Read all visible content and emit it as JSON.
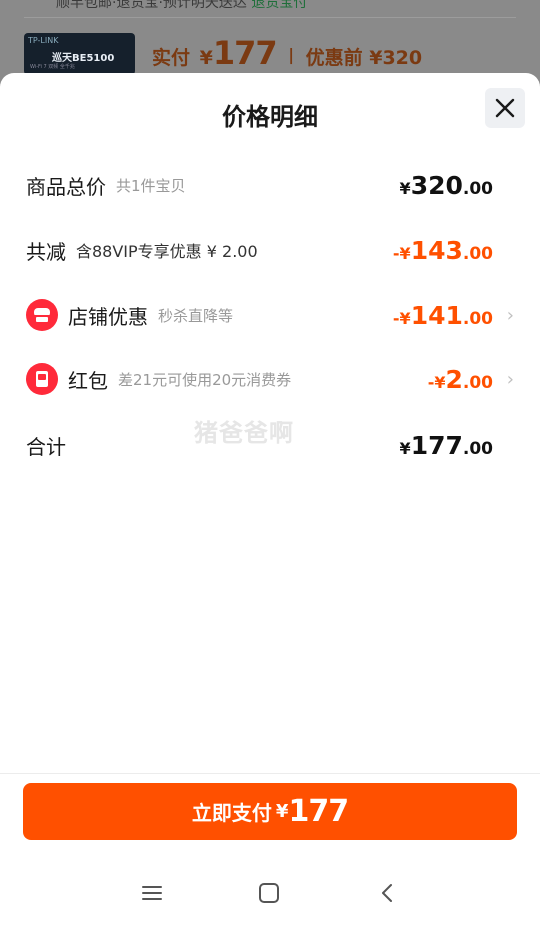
{
  "background": {
    "strip_text": "顺丰包邮·退货宝·预计明天送达",
    "strip_green": "退货宝付",
    "thumbnail_tag": "TP-LINK",
    "thumbnail_title": "巡天BE5100",
    "thumbnail_sub": "Wi-Fi 7 双频 全千兆",
    "price_label": "实付",
    "price_yen": "¥",
    "price_value": "177",
    "price_before": "优惠前 ¥320"
  },
  "sheet": {
    "title": "价格明细",
    "rows": [
      {
        "label": "商品总价",
        "sub": "共1件宝贝",
        "yen": "¥",
        "int": "320",
        "dec": ".00"
      },
      {
        "label": "共减",
        "sub": "含88VIP专享优惠 ¥ 2.00",
        "yen": "-¥",
        "int": "143",
        "dec": ".00"
      },
      {
        "label": "店铺优惠",
        "sub": "秒杀直降等",
        "yen": "-¥",
        "int": "141",
        "dec": ".00",
        "icon": "store-icon"
      },
      {
        "label": "红包",
        "sub": "差21元可使用20元消费券",
        "yen": "-¥",
        "int": "2",
        "dec": ".00",
        "icon": "red-packet-icon"
      },
      {
        "label": "合计",
        "yen": "¥",
        "int": "177",
        "dec": ".00"
      }
    ],
    "watermark": "猪爸爸啊"
  },
  "pay_button": {
    "label": "立即支付",
    "yen": "¥",
    "amount": "177"
  },
  "colors": {
    "accent": "#ff5000",
    "icon_red": "#ff2a3a"
  },
  "nav": [
    "menu-icon",
    "home-icon",
    "back-icon"
  ]
}
